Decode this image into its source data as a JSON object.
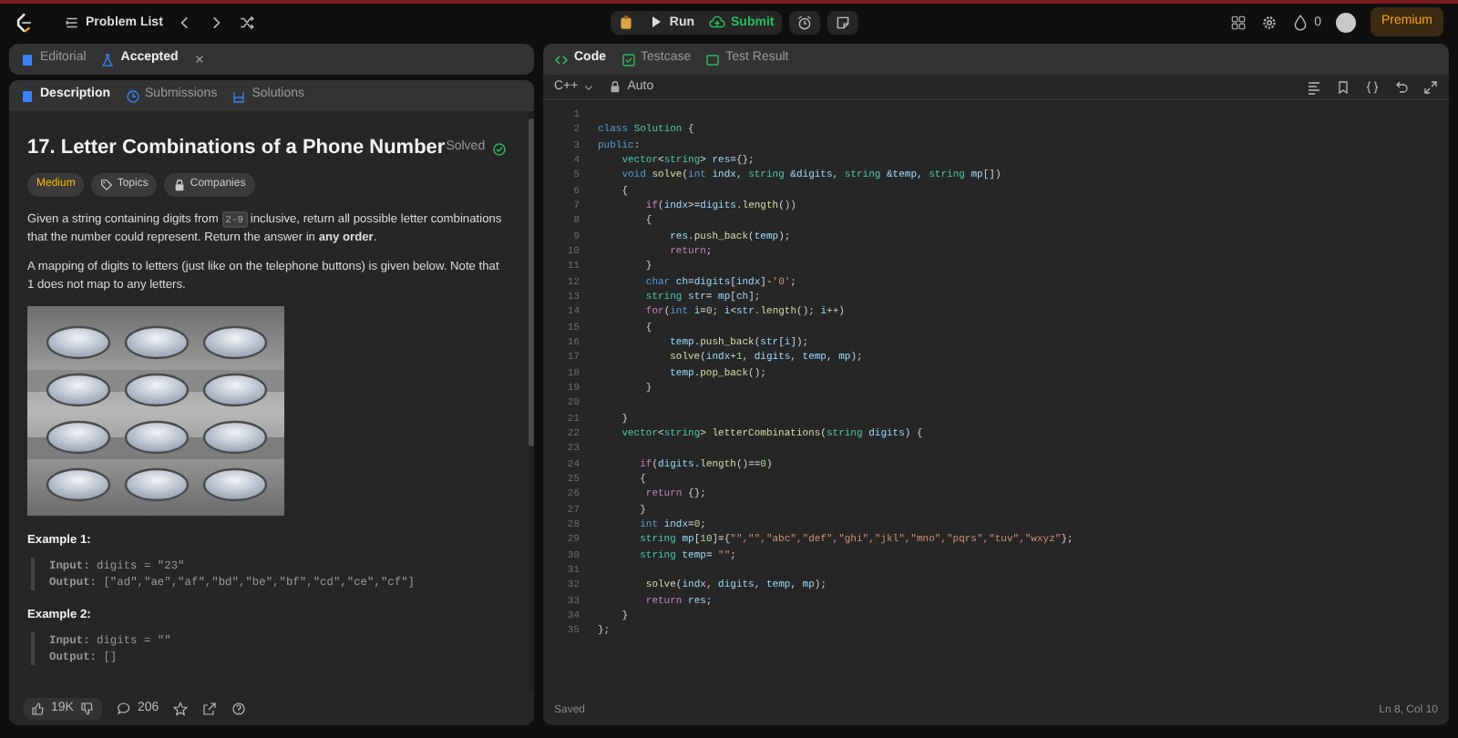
{
  "top_bar": {
    "nav_title": "Problem List",
    "run_label": "Run",
    "submit_label": "Submit",
    "streak_count": "0",
    "premium_label": "Premium"
  },
  "left_tabs": [
    {
      "label": "Editorial",
      "selected": false,
      "closable": false
    },
    {
      "label": "Accepted",
      "selected": true,
      "closable": true
    }
  ],
  "description_tabs": [
    {
      "label": "Description",
      "selected": true
    },
    {
      "label": "Submissions",
      "selected": false
    },
    {
      "label": "Solutions",
      "selected": false
    }
  ],
  "problem": {
    "title": "17. Letter Combinations of a Phone Number",
    "status": "Solved",
    "tags": [
      {
        "kind": "difficulty",
        "label": "Medium"
      },
      {
        "kind": "topics",
        "label": "Topics"
      },
      {
        "kind": "companies",
        "label": "Companies"
      }
    ],
    "paragraphs": [
      [
        {
          "kind": "text",
          "text": "Given a string containing digits from "
        },
        {
          "kind": "code",
          "text": "2-9"
        },
        {
          "kind": "text",
          "text": " inclusive, return all possible letter combinations that the number could represent. Return the answer in **any order**."
        }
      ],
      [
        {
          "kind": "text",
          "text": "A mapping of digits to letters (just like on the telephone buttons) is given below. Note that 1 does not map to any letters."
        }
      ]
    ],
    "image": {
      "kind": "picture"
    },
    "examples": [
      {
        "title": "Example 1:",
        "lines": [
          "**Input:** digits = \"23\"",
          "**Output:** [\"ad\",\"ae\",\"af\",\"bd\",\"be\",\"bf\",\"cd\",\"ce\",\"cf\"]"
        ]
      },
      {
        "title": "Example 2:",
        "lines": [
          "**Input:** digits = \"\"",
          "**Output:** []"
        ]
      }
    ]
  },
  "footer": {
    "likes": "19K",
    "comments": "206"
  },
  "editor": {
    "tabs": [
      {
        "label": "Code",
        "selected": true
      },
      {
        "label": "Testcase",
        "selected": false
      },
      {
        "label": "Test Result",
        "selected": false
      }
    ],
    "language": "C++",
    "mode": "Auto",
    "lines": [
      {
        "n": "1"
      },
      {
        "n": "2",
        "parts": [
          {
            "kind": "k",
            "text": "class"
          },
          {
            "kind": "t",
            "text": " Solution"
          },
          {
            "kind": "p",
            "text": " {"
          }
        ]
      },
      {
        "n": "3",
        "parts": [
          {
            "kind": "k",
            "text": "public"
          },
          {
            "kind": "p",
            "text": ":"
          }
        ]
      },
      {
        "n": "4",
        "parts": [
          {
            "kind": "t",
            "text": "    vector"
          },
          {
            "kind": "p",
            "text": "<"
          },
          {
            "kind": "t",
            "text": "string"
          },
          {
            "kind": "p",
            "text": ">"
          },
          {
            "kind": "v",
            "text": " res"
          },
          {
            "kind": "p",
            "text": "={};"
          }
        ]
      },
      {
        "n": "5",
        "parts": [
          {
            "kind": "k",
            "text": "    void"
          },
          {
            "kind": "f",
            "text": " solve"
          },
          {
            "kind": "p",
            "text": "("
          },
          {
            "kind": "k",
            "text": "int"
          },
          {
            "kind": "v",
            "text": " indx"
          },
          {
            "kind": "p",
            "text": ","
          },
          {
            "kind": "t",
            "text": " string"
          },
          {
            "kind": "v",
            "text": " &digits"
          },
          {
            "kind": "p",
            "text": ","
          },
          {
            "kind": "t",
            "text": " string"
          },
          {
            "kind": "v",
            "text": " &temp"
          },
          {
            "kind": "p",
            "text": ","
          },
          {
            "kind": "t",
            "text": " string"
          },
          {
            "kind": "v",
            "text": " mp"
          },
          {
            "kind": "p",
            "text": "[])"
          }
        ]
      },
      {
        "n": "6",
        "parts": [
          {
            "kind": "p",
            "text": "    {"
          }
        ]
      },
      {
        "n": "7",
        "parts": [
          {
            "kind": "c",
            "text": "        if"
          },
          {
            "kind": "p",
            "text": "("
          },
          {
            "kind": "v",
            "text": "indx"
          },
          {
            "kind": "p",
            "text": ">="
          },
          {
            "kind": "v",
            "text": "digits"
          },
          {
            "kind": "p",
            "text": "."
          },
          {
            "kind": "f",
            "text": "length"
          },
          {
            "kind": "p",
            "text": "())"
          }
        ]
      },
      {
        "n": "8",
        "parts": [
          {
            "kind": "p",
            "text": "        {"
          }
        ]
      },
      {
        "n": "9",
        "parts": [
          {
            "kind": "v",
            "text": "            res"
          },
          {
            "kind": "p",
            "text": "."
          },
          {
            "kind": "f",
            "text": "push_back"
          },
          {
            "kind": "p",
            "text": "("
          },
          {
            "kind": "v",
            "text": "temp"
          },
          {
            "kind": "p",
            "text": ");"
          }
        ]
      },
      {
        "n": "10",
        "parts": [
          {
            "kind": "c",
            "text": "            return"
          },
          {
            "kind": "p",
            "text": ";"
          }
        ]
      },
      {
        "n": "11",
        "parts": [
          {
            "kind": "p",
            "text": "        }"
          }
        ]
      },
      {
        "n": "12",
        "parts": [
          {
            "kind": "k",
            "text": "        char"
          },
          {
            "kind": "v",
            "text": " ch"
          },
          {
            "kind": "p",
            "text": "="
          },
          {
            "kind": "v",
            "text": "digits"
          },
          {
            "kind": "p",
            "text": "["
          },
          {
            "kind": "v",
            "text": "indx"
          },
          {
            "kind": "p",
            "text": "]-"
          },
          {
            "kind": "s",
            "text": "'0'"
          },
          {
            "kind": "p",
            "text": ";"
          }
        ]
      },
      {
        "n": "13",
        "parts": [
          {
            "kind": "t",
            "text": "        string"
          },
          {
            "kind": "v",
            "text": " str"
          },
          {
            "kind": "p",
            "text": "="
          },
          {
            "kind": "v",
            "text": " mp"
          },
          {
            "kind": "p",
            "text": "["
          },
          {
            "kind": "v",
            "text": "ch"
          },
          {
            "kind": "p",
            "text": "];"
          }
        ]
      },
      {
        "n": "14",
        "parts": [
          {
            "kind": "c",
            "text": "        for"
          },
          {
            "kind": "p",
            "text": "("
          },
          {
            "kind": "k",
            "text": "int"
          },
          {
            "kind": "v",
            "text": " i"
          },
          {
            "kind": "p",
            "text": "="
          },
          {
            "kind": "n",
            "text": "0"
          },
          {
            "kind": "p",
            "text": ";"
          },
          {
            "kind": "v",
            "text": " i"
          },
          {
            "kind": "p",
            "text": "<"
          },
          {
            "kind": "v",
            "text": "str"
          },
          {
            "kind": "p",
            "text": "."
          },
          {
            "kind": "f",
            "text": "length"
          },
          {
            "kind": "p",
            "text": "();"
          },
          {
            "kind": "v",
            "text": " i"
          },
          {
            "kind": "p",
            "text": "++)"
          }
        ]
      },
      {
        "n": "15",
        "parts": [
          {
            "kind": "p",
            "text": "        {"
          }
        ]
      },
      {
        "n": "16",
        "parts": [
          {
            "kind": "v",
            "text": "            temp"
          },
          {
            "kind": "p",
            "text": "."
          },
          {
            "kind": "f",
            "text": "push_back"
          },
          {
            "kind": "p",
            "text": "("
          },
          {
            "kind": "v",
            "text": "str"
          },
          {
            "kind": "p",
            "text": "["
          },
          {
            "kind": "v",
            "text": "i"
          },
          {
            "kind": "p",
            "text": "]);"
          }
        ]
      },
      {
        "n": "17",
        "parts": [
          {
            "kind": "f",
            "text": "            solve"
          },
          {
            "kind": "p",
            "text": "("
          },
          {
            "kind": "v",
            "text": "indx"
          },
          {
            "kind": "p",
            "text": "+"
          },
          {
            "kind": "n",
            "text": "1"
          },
          {
            "kind": "p",
            "text": ","
          },
          {
            "kind": "v",
            "text": " digits"
          },
          {
            "kind": "p",
            "text": ","
          },
          {
            "kind": "v",
            "text": " temp"
          },
          {
            "kind": "p",
            "text": ","
          },
          {
            "kind": "v",
            "text": " mp"
          },
          {
            "kind": "p",
            "text": ");"
          }
        ]
      },
      {
        "n": "18",
        "parts": [
          {
            "kind": "v",
            "text": "            temp"
          },
          {
            "kind": "p",
            "text": "."
          },
          {
            "kind": "f",
            "text": "pop_back"
          },
          {
            "kind": "p",
            "text": "();"
          }
        ]
      },
      {
        "n": "19",
        "parts": [
          {
            "kind": "p",
            "text": "        }"
          }
        ]
      },
      {
        "n": "20"
      },
      {
        "n": "21",
        "parts": [
          {
            "kind": "p",
            "text": "    }"
          }
        ]
      },
      {
        "n": "22",
        "parts": [
          {
            "kind": "t",
            "text": "    vector"
          },
          {
            "kind": "p",
            "text": "<"
          },
          {
            "kind": "t",
            "text": "string"
          },
          {
            "kind": "p",
            "text": ">"
          },
          {
            "kind": "f",
            "text": " letterCombinations"
          },
          {
            "kind": "p",
            "text": "("
          },
          {
            "kind": "t",
            "text": "string"
          },
          {
            "kind": "v",
            "text": " digits"
          },
          {
            "kind": "p",
            "text": ") {"
          }
        ]
      },
      {
        "n": "23"
      },
      {
        "n": "24",
        "parts": [
          {
            "kind": "c",
            "text": "       if"
          },
          {
            "kind": "p",
            "text": "("
          },
          {
            "kind": "v",
            "text": "digits"
          },
          {
            "kind": "p",
            "text": "."
          },
          {
            "kind": "f",
            "text": "length"
          },
          {
            "kind": "p",
            "text": "()=="
          },
          {
            "kind": "n",
            "text": "0"
          },
          {
            "kind": "p",
            "text": ")"
          }
        ]
      },
      {
        "n": "25",
        "parts": [
          {
            "kind": "p",
            "text": "       {"
          }
        ]
      },
      {
        "n": "26",
        "parts": [
          {
            "kind": "c",
            "text": "        return"
          },
          {
            "kind": "p",
            "text": " {};"
          }
        ]
      },
      {
        "n": "27",
        "parts": [
          {
            "kind": "p",
            "text": "       }"
          }
        ]
      },
      {
        "n": "28",
        "parts": [
          {
            "kind": "k",
            "text": "       int"
          },
          {
            "kind": "v",
            "text": " indx"
          },
          {
            "kind": "p",
            "text": "="
          },
          {
            "kind": "n",
            "text": "0"
          },
          {
            "kind": "p",
            "text": ";"
          }
        ]
      },
      {
        "n": "29",
        "parts": [
          {
            "kind": "t",
            "text": "       string"
          },
          {
            "kind": "v",
            "text": " mp"
          },
          {
            "kind": "p",
            "text": "["
          },
          {
            "kind": "n",
            "text": "10"
          },
          {
            "kind": "p",
            "text": "]={"
          },
          {
            "kind": "s",
            "text": "\"\",\"\",\"abc\",\"def\",\"ghi\",\"jkl\",\"mno\",\"pqrs\",\"tuv\",\"wxyz\""
          },
          {
            "kind": "p",
            "text": "};"
          }
        ]
      },
      {
        "n": "30",
        "parts": [
          {
            "kind": "t",
            "text": "       string"
          },
          {
            "kind": "v",
            "text": " temp"
          },
          {
            "kind": "p",
            "text": "="
          },
          {
            "kind": "s",
            "text": " \"\""
          },
          {
            "kind": "p",
            "text": ";"
          }
        ]
      },
      {
        "n": "31"
      },
      {
        "n": "32",
        "parts": [
          {
            "kind": "f",
            "text": "        solve"
          },
          {
            "kind": "p",
            "text": "("
          },
          {
            "kind": "v",
            "text": "indx"
          },
          {
            "kind": "p",
            "text": ","
          },
          {
            "kind": "v",
            "text": " digits"
          },
          {
            "kind": "p",
            "text": ","
          },
          {
            "kind": "v",
            "text": " temp"
          },
          {
            "kind": "p",
            "text": ","
          },
          {
            "kind": "v",
            "text": " mp"
          },
          {
            "kind": "p",
            "text": ");"
          }
        ]
      },
      {
        "n": "33",
        "parts": [
          {
            "kind": "c",
            "text": "        return"
          },
          {
            "kind": "v",
            "text": " res"
          },
          {
            "kind": "p",
            "text": ";"
          }
        ]
      },
      {
        "n": "34",
        "parts": [
          {
            "kind": "p",
            "text": "    }"
          }
        ]
      },
      {
        "n": "35",
        "parts": [
          {
            "kind": "p",
            "text": "};"
          }
        ]
      }
    ],
    "status": "Saved",
    "cursor": "Ln 8, Col 10"
  }
}
